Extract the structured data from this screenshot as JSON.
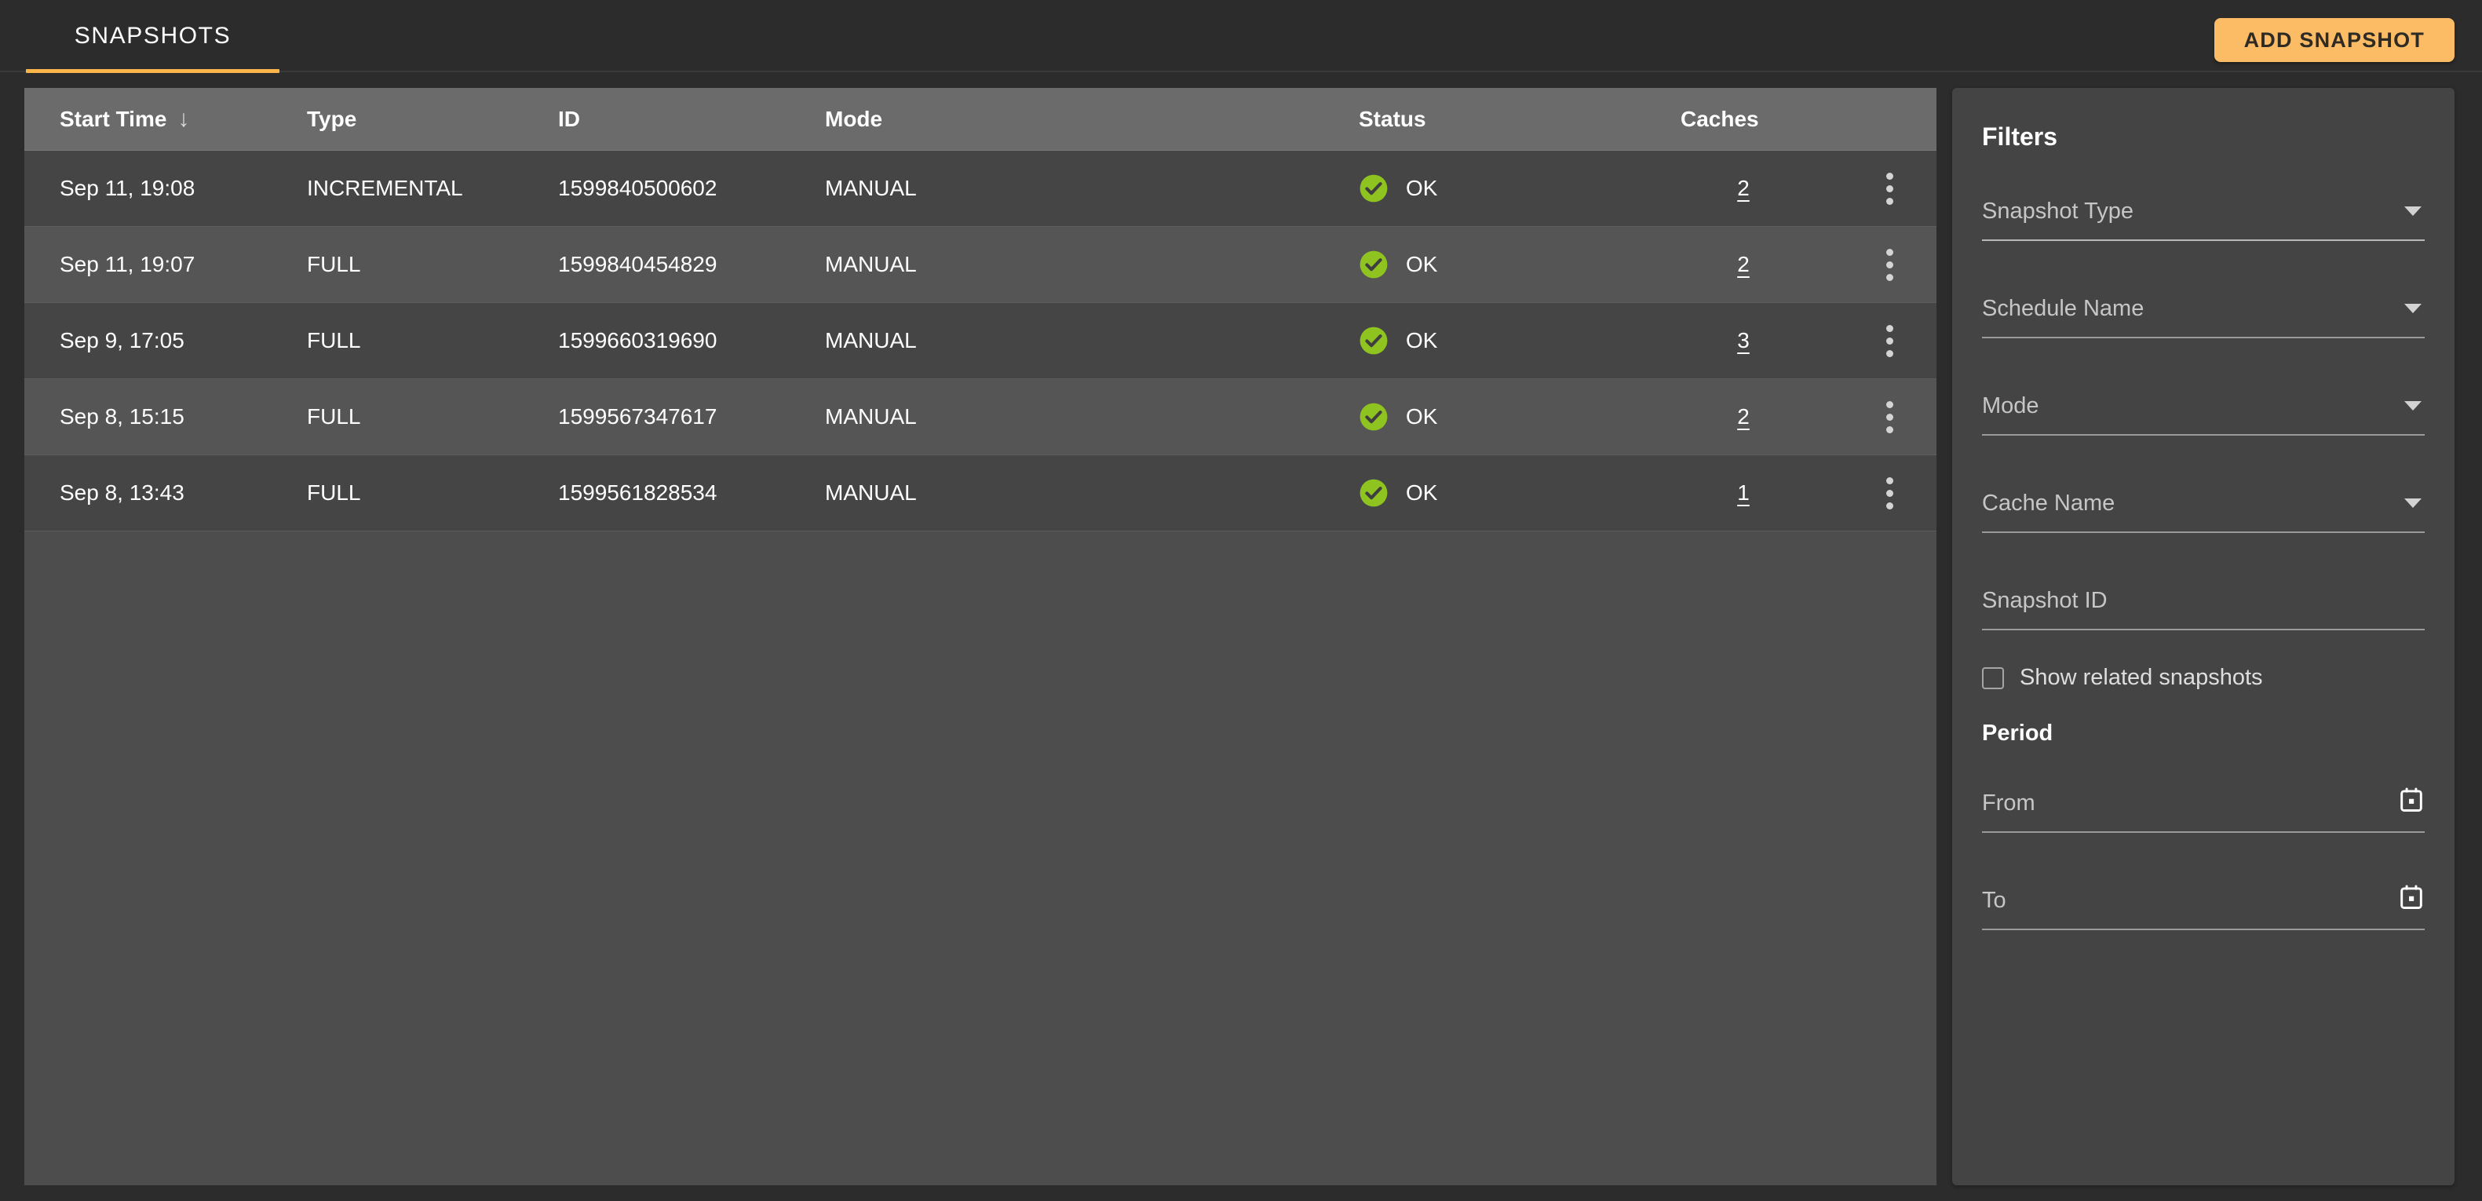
{
  "theme": {
    "accent": "#fbb64b",
    "button_bg": "#fcbc65",
    "status_ok_color": "#8fc31f",
    "page_bg": "#2c2c2c",
    "table_header_bg": "#6b6b6b"
  },
  "header": {
    "tab_label": "SNAPSHOTS",
    "add_button_label": "ADD SNAPSHOT"
  },
  "table": {
    "columns": [
      {
        "label": "Start Time",
        "sort_icon": "arrow-down-icon",
        "sort_glyph": "↓"
      },
      {
        "label": "Type"
      },
      {
        "label": "ID"
      },
      {
        "label": "Mode"
      },
      {
        "label": "Status"
      },
      {
        "label": "Caches"
      }
    ],
    "rows": [
      {
        "start_time": "Sep 11, 19:08",
        "type": "INCREMENTAL",
        "id": "1599840500602",
        "mode": "MANUAL",
        "status": "OK",
        "status_icon": "check-circle-icon",
        "caches": "2",
        "menu_icon": "kebab-menu-icon"
      },
      {
        "start_time": "Sep 11, 19:07",
        "type": "FULL",
        "id": "1599840454829",
        "mode": "MANUAL",
        "status": "OK",
        "status_icon": "check-circle-icon",
        "caches": "2",
        "menu_icon": "kebab-menu-icon"
      },
      {
        "start_time": "Sep 9, 17:05",
        "type": "FULL",
        "id": "1599660319690",
        "mode": "MANUAL",
        "status": "OK",
        "status_icon": "check-circle-icon",
        "caches": "3",
        "menu_icon": "kebab-menu-icon"
      },
      {
        "start_time": "Sep 8, 15:15",
        "type": "FULL",
        "id": "1599567347617",
        "mode": "MANUAL",
        "status": "OK",
        "status_icon": "check-circle-icon",
        "caches": "2",
        "menu_icon": "kebab-menu-icon"
      },
      {
        "start_time": "Sep 8, 13:43",
        "type": "FULL",
        "id": "1599561828534",
        "mode": "MANUAL",
        "status": "OK",
        "status_icon": "check-circle-icon",
        "caches": "1",
        "menu_icon": "kebab-menu-icon"
      }
    ]
  },
  "filters": {
    "title": "Filters",
    "snapshot_type": {
      "label": "Snapshot Type",
      "value": "",
      "icon": "chevron-down-icon"
    },
    "schedule_name": {
      "label": "Schedule Name",
      "value": "",
      "icon": "chevron-down-icon"
    },
    "mode": {
      "label": "Mode",
      "value": "",
      "icon": "chevron-down-icon"
    },
    "cache_name": {
      "label": "Cache Name",
      "value": "",
      "icon": "chevron-down-icon"
    },
    "snapshot_id": {
      "label": "Snapshot ID",
      "value": ""
    },
    "show_related": {
      "label": "Show related snapshots",
      "checked": false
    },
    "period": {
      "title": "Period",
      "from": {
        "label": "From",
        "value": "",
        "icon": "calendar-icon"
      },
      "to": {
        "label": "To",
        "value": "",
        "icon": "calendar-icon"
      }
    }
  }
}
